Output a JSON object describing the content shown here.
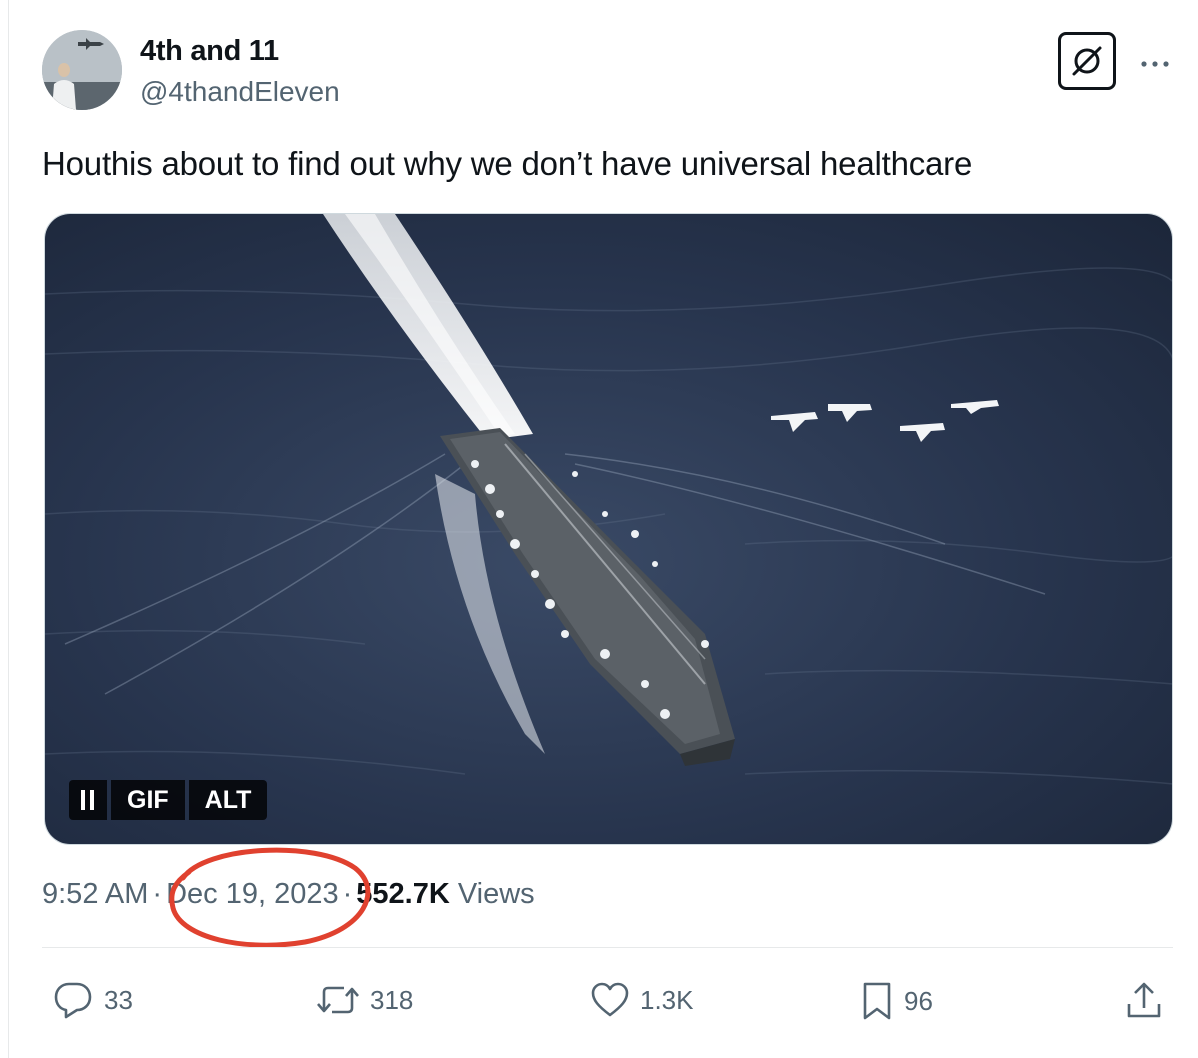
{
  "author": {
    "name": "4th and 11",
    "handle": "@4thandEleven"
  },
  "tweet": {
    "text": "Houthis about to find out why we don’t have universal healthcare"
  },
  "media": {
    "pause_label": "II",
    "gif_label": "GIF",
    "alt_label": "ALT"
  },
  "meta": {
    "time": "9:52 AM",
    "separator": "·",
    "date": "Dec 19, 2023",
    "views_count": "552.7K",
    "views_label": "Views"
  },
  "actions": {
    "replies": "33",
    "reposts": "318",
    "likes": "1.3K",
    "bookmarks": "96"
  },
  "icons": {
    "grok": "slashed-circle-icon",
    "more": "ellipsis-icon",
    "reply": "reply-icon",
    "repost": "repost-icon",
    "like": "heart-icon",
    "bookmark": "bookmark-icon",
    "share": "share-icon"
  },
  "colors": {
    "annotation_circle": "#e0412f",
    "text_secondary": "#536471",
    "text_primary": "#0f1419"
  }
}
